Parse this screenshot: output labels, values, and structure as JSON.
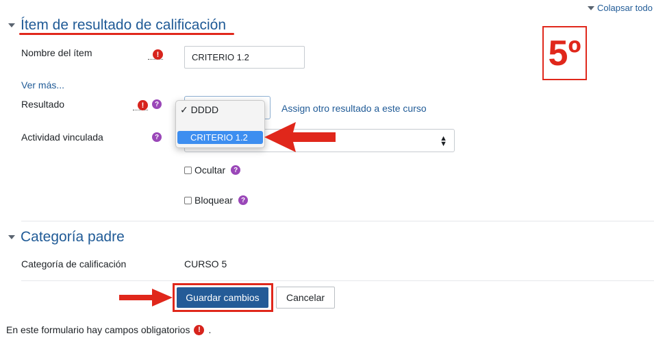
{
  "header": {
    "collapse_all": "Colapsar todo"
  },
  "section1": {
    "title": "Ítem de resultado de calificación"
  },
  "fields": {
    "item_name": {
      "label": "Nombre del ítem",
      "value": "CRITERIO 1.2"
    },
    "show_more": "Ver más...",
    "outcome": {
      "label": "Resultado",
      "assign_link": "Assign otro resultado a este curso"
    },
    "linked_activity": {
      "label": "Actividad vinculada"
    },
    "hidden": {
      "label": "Ocultar"
    },
    "locked": {
      "label": "Bloquear"
    }
  },
  "dropdown": {
    "options": [
      {
        "label": "DDDD",
        "checked": true
      },
      {
        "label": "CRITERIO 1.2",
        "highlighted": true
      }
    ]
  },
  "section2": {
    "title": "Categoría padre"
  },
  "category": {
    "label": "Categoría de calificación",
    "value": "CURSO 5"
  },
  "buttons": {
    "save": "Guardar cambios",
    "cancel": "Cancelar"
  },
  "footer": {
    "required_note": "En este formulario hay campos obligatorios",
    "period": "."
  },
  "annotation": {
    "step": "5º"
  },
  "colors": {
    "link": "#1f5a96",
    "primary": "#245b97",
    "annotation_red": "#e0271b",
    "highlight": "#3d8ef0"
  }
}
